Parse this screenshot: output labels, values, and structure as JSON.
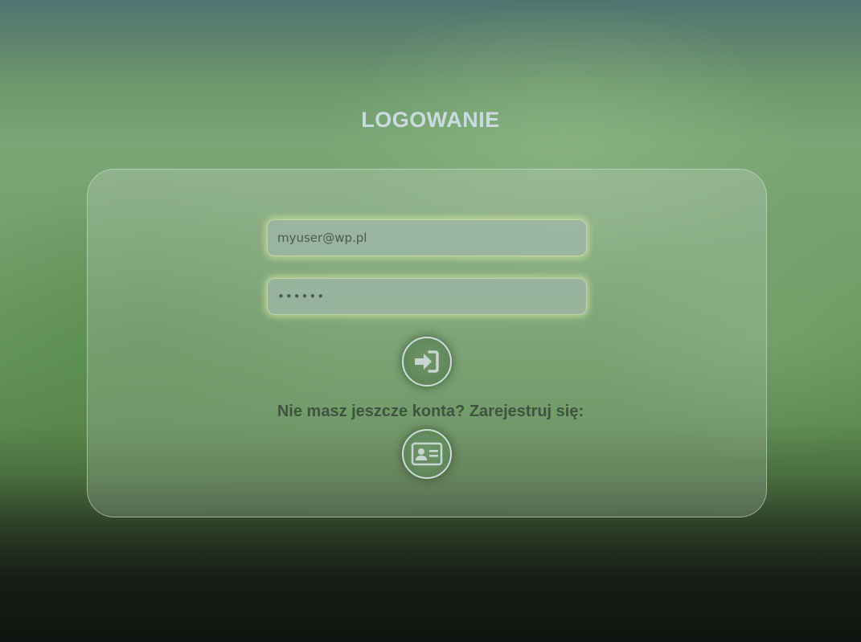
{
  "page": {
    "title": "LOGOWANIE"
  },
  "form": {
    "email_value": "myuser@wp.pl",
    "password_value": "••••••",
    "login_icon": "sign-in-arrow-icon",
    "register_prompt": "Nie masz jeszcze konta? Zarejestruj się:",
    "register_icon": "id-card-icon"
  },
  "colors": {
    "title": "#c9dbe0",
    "button_fill": "#5f8759",
    "button_border": "#cfdbd8",
    "input_glow": "#e1f0aa",
    "prompt_text": "#3f5340"
  }
}
